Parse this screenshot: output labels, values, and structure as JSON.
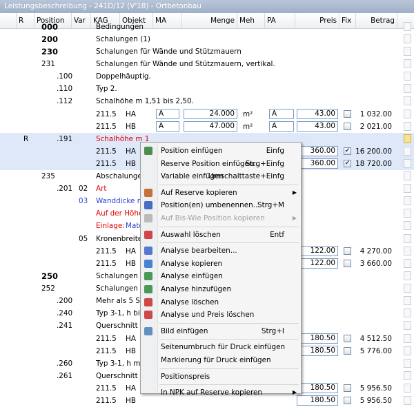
{
  "window": {
    "title": "Leistungsbeschreibung - 241D/12 (V'18) - Ortbetonbau"
  },
  "columns": [
    "R",
    "Position",
    "Var",
    "KAG",
    "Objekt",
    "MA",
    "Menge",
    "Meh",
    "PA",
    "Preis",
    "Fix",
    "Betrag"
  ],
  "rows": [
    {
      "pos": "000",
      "text": "Bedingungen",
      "bold": true
    },
    {
      "pos": "200",
      "text": "Schalungen (1)",
      "bold": true
    },
    {
      "pos": "230",
      "text": "Schalungen für Wände und Stützmauern",
      "bold": true
    },
    {
      "pos": "231",
      "text": "Schalungen für Wände und Stützmauern, vertikal."
    },
    {
      "pos": ".100",
      "text": "Doppelhäuptig."
    },
    {
      "pos": ".110",
      "text": "Typ 2."
    },
    {
      "pos": ".112",
      "text": "Schalhöhe m 1,51 bis 2,50."
    },
    {
      "kag": "211.5",
      "obj": "HA",
      "ma": "A",
      "menge": "24.000",
      "meh": "m²",
      "pa": "A",
      "preis": "43.00",
      "betrag": "1 032.00"
    },
    {
      "kag": "211.5",
      "obj": "HB",
      "ma": "A",
      "menge": "47.000",
      "meh": "m²",
      "pa": "A",
      "preis": "43.00",
      "betrag": "2 021.00"
    },
    {
      "r": "R",
      "pos": ".191",
      "text": "Schalhöhe m 1",
      "red": true
    },
    {
      "kag": "211.5",
      "obj": "HA",
      "preis": "360.00",
      "checked": true,
      "betrag": "16 200.00"
    },
    {
      "kag": "211.5",
      "obj": "HB",
      "preis": "360.00",
      "checked": true,
      "betrag": "18 720.00"
    },
    {
      "pos": "235",
      "text": "Abschalungen"
    },
    {
      "pos": ".201",
      "var": "02",
      "text": "Art",
      "red": true
    },
    {
      "var": "03",
      "text": "Wanddicke m",
      "blue": true
    },
    {
      "text": "Auf der Höhe",
      "red": true
    },
    {
      "text_a": "Einlage:",
      "text_b": "Materi"
    },
    {
      "var": "05",
      "text": "Kronenbreite m"
    },
    {
      "kag": "211.5",
      "obj": "HA",
      "preis": "122.00",
      "betrag": "4 270.00"
    },
    {
      "kag": "211.5",
      "obj": "HB",
      "preis": "122.00",
      "betrag": "3 660.00"
    },
    {
      "pos": "250",
      "text": "Schalungen für",
      "bold": true
    },
    {
      "pos": "252",
      "text": "Schalungen für"
    },
    {
      "pos": ".200",
      "text": "Mehr als 5 Stü"
    },
    {
      "pos": ".240",
      "text": "Typ 3-1, h bis"
    },
    {
      "pos": ".241",
      "text": "Querschnitt bis"
    },
    {
      "kag": "211.5",
      "obj": "HA",
      "preis": "180.50",
      "betrag": "4 512.50"
    },
    {
      "kag": "211.5",
      "obj": "HB",
      "preis": "180.50",
      "betrag": "5 776.00"
    },
    {
      "pos": ".260",
      "text": "Typ 3-1, h m 2"
    },
    {
      "pos": ".261",
      "text": "Querschnitt bis"
    },
    {
      "kag": "211.5",
      "obj": "HA",
      "preis": "180.50",
      "betrag": "5 956.50"
    },
    {
      "kag": "211.5",
      "obj": "HB",
      "preis": "180.50",
      "betrag": "5 956.50"
    }
  ],
  "menu": {
    "items": [
      {
        "label": "Position einfügen",
        "shortcut": "Einfg",
        "icon": "insert-position-icon"
      },
      {
        "label": "Reserve Position einfügen...",
        "shortcut": "Strg+Einfg"
      },
      {
        "label": "Variable einfügen",
        "shortcut": "Umschalttaste+Einfg"
      },
      {
        "sep": true
      },
      {
        "label": "Auf Reserve kopieren",
        "submenu": true,
        "icon": "copy-reserve-icon"
      },
      {
        "label": "Position(en) umbenennen...",
        "shortcut": "Strg+M",
        "icon": "rename-icon"
      },
      {
        "label": "Auf Bis-Wie Position kopieren",
        "submenu": true,
        "disabled": true,
        "icon": "copy-bis-wie-icon"
      },
      {
        "sep": true
      },
      {
        "label": "Auswahl löschen",
        "shortcut": "Entf",
        "icon": "delete-selection-icon"
      },
      {
        "sep": true
      },
      {
        "label": "Analyse bearbeiten...",
        "icon": "edit-analysis-icon"
      },
      {
        "label": "Analyse kopieren",
        "icon": "copy-analysis-icon"
      },
      {
        "label": "Analyse einfügen",
        "icon": "paste-analysis-icon"
      },
      {
        "label": "Analyse hinzufügen",
        "icon": "add-analysis-icon"
      },
      {
        "label": "Analyse löschen",
        "icon": "delete-analysis-icon"
      },
      {
        "label": "Analyse und Preis löschen",
        "icon": "delete-analysis-price-icon"
      },
      {
        "sep": true
      },
      {
        "label": "Bild einfügen",
        "shortcut": "Strg+I",
        "icon": "insert-image-icon"
      },
      {
        "sep": true
      },
      {
        "label": "Seitenumbruch für Druck einfügen"
      },
      {
        "label": "Markierung für Druck einfügen"
      },
      {
        "sep": true
      },
      {
        "label": "Positionspreis"
      },
      {
        "sep": true
      },
      {
        "label": "In NPK auf Reserve kopieren",
        "submenu": true
      }
    ]
  }
}
